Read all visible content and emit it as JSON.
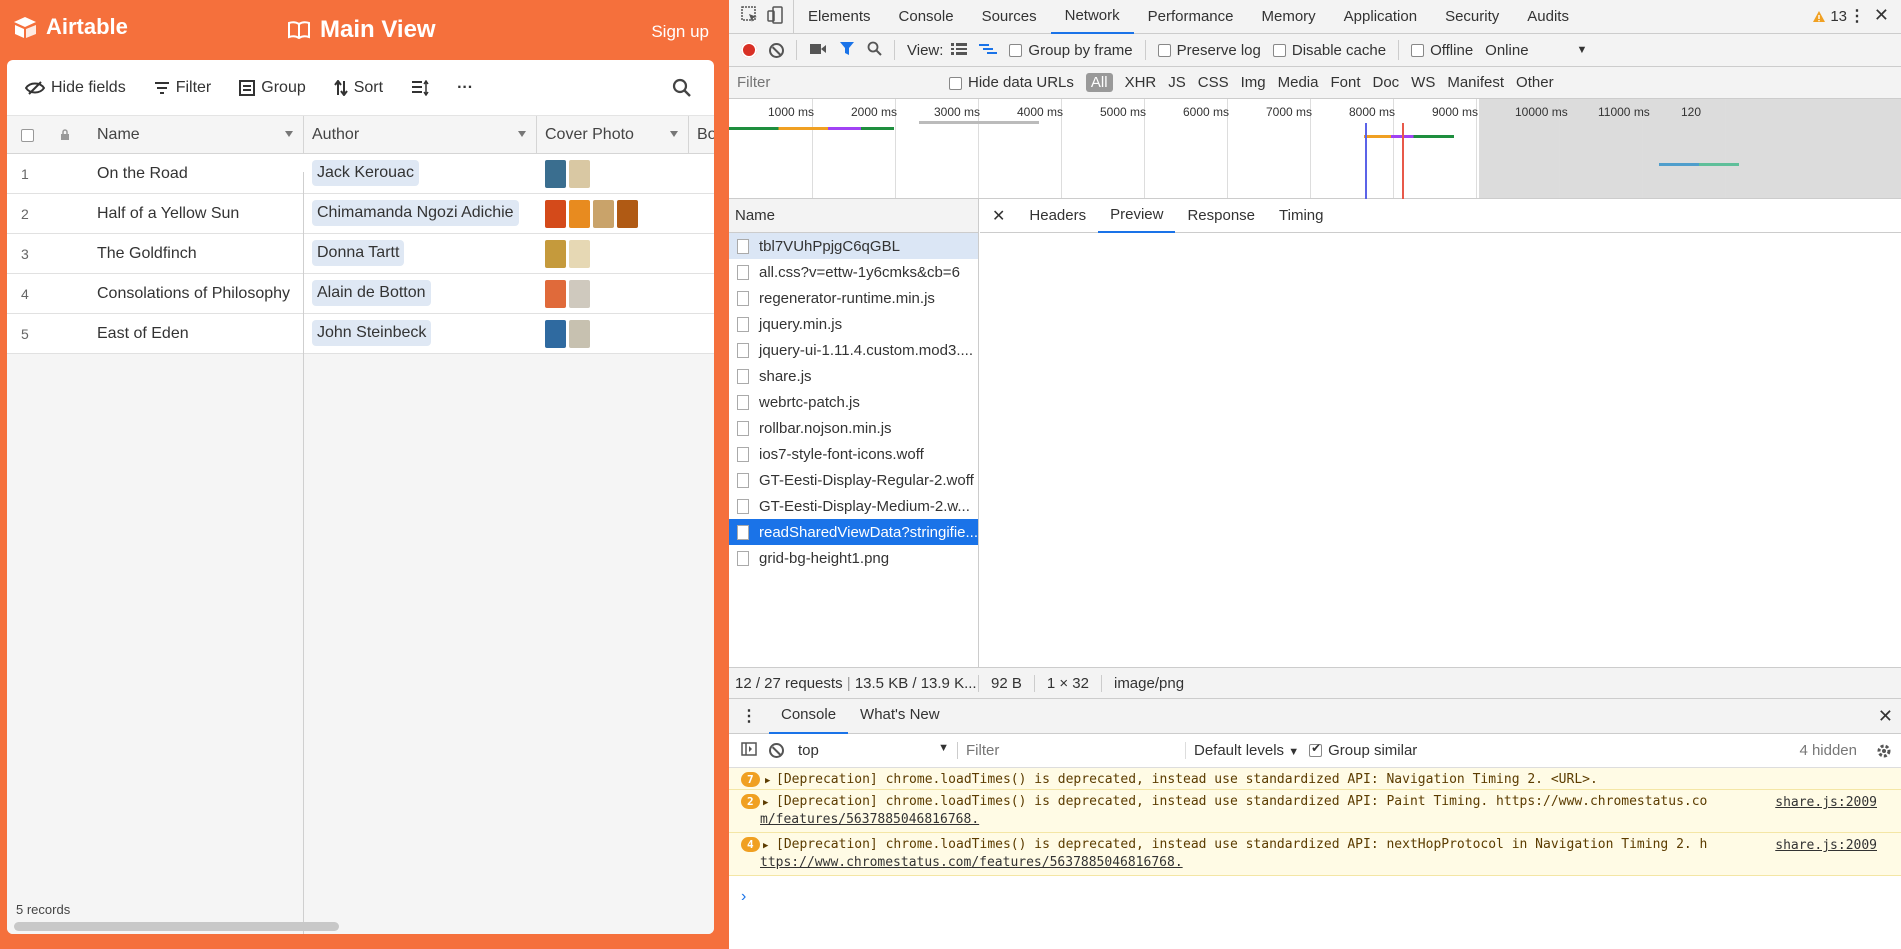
{
  "airtable": {
    "logo_text": "Airtable",
    "view_title": "Main View",
    "signup": "Sign up",
    "toolbar": {
      "hide_fields": "Hide fields",
      "filter": "Filter",
      "group": "Group",
      "sort": "Sort",
      "more": "···"
    },
    "columns": {
      "name": "Name",
      "author": "Author",
      "cover": "Cover Photo",
      "extra": "Bo"
    },
    "rows": [
      {
        "num": "1",
        "name": "On the Road",
        "author": "Jack Kerouac",
        "thumbs": 2
      },
      {
        "num": "2",
        "name": "Half of a Yellow Sun",
        "author": "Chimamanda Ngozi Adichie",
        "thumbs": 4
      },
      {
        "num": "3",
        "name": "The Goldfinch",
        "author": "Donna Tartt",
        "thumbs": 2
      },
      {
        "num": "4",
        "name": "Consolations of Philosophy",
        "author": "Alain de Botton",
        "thumbs": 2
      },
      {
        "num": "5",
        "name": "East of Eden",
        "author": "John Steinbeck",
        "thumbs": 2
      }
    ],
    "records": "5 records",
    "brand_color": "#f5703c"
  },
  "devtools": {
    "tabs": [
      "Elements",
      "Console",
      "Sources",
      "Network",
      "Performance",
      "Memory",
      "Application",
      "Security",
      "Audits"
    ],
    "active_tab": "Network",
    "warning_count": "13",
    "controls": {
      "view": "View:",
      "group_by_frame": "Group by frame",
      "preserve_log": "Preserve log",
      "disable_cache": "Disable cache",
      "offline": "Offline",
      "throttle": "Online"
    },
    "filter": {
      "placeholder": "Filter",
      "hide_data_urls": "Hide data URLs",
      "types": [
        "All",
        "XHR",
        "JS",
        "CSS",
        "Img",
        "Media",
        "Font",
        "Doc",
        "WS",
        "Manifest",
        "Other"
      ]
    },
    "timeline_ticks": [
      "1000 ms",
      "2000 ms",
      "3000 ms",
      "4000 ms",
      "5000 ms",
      "6000 ms",
      "7000 ms",
      "8000 ms",
      "9000 ms",
      "10000 ms",
      "11000 ms",
      "120"
    ],
    "name_header": "Name",
    "requests": [
      "tbl7VUhPpjgC6qGBL",
      "all.css?v=ettw-1y6cmks&cb=6",
      "regenerator-runtime.min.js",
      "jquery.min.js",
      "jquery-ui-1.11.4.custom.mod3....",
      "share.js",
      "webrtc-patch.js",
      "rollbar.nojson.min.js",
      "ios7-style-font-icons.woff",
      "GT-Eesti-Display-Regular-2.woff",
      "GT-Eesti-Display-Medium-2.w...",
      "readSharedViewData?stringifie...",
      "grid-bg-height1.png"
    ],
    "detail_tabs": [
      "Headers",
      "Preview",
      "Response",
      "Timing"
    ],
    "active_detail_tab": "Preview",
    "status": {
      "requests": "12 / 27 requests",
      "transferred": "13.5 KB / 13.9 K...",
      "size": "92 B",
      "dims": "1 × 32",
      "mime": "image/png"
    },
    "drawer_tabs": [
      "Console",
      "What's New"
    ],
    "console": {
      "context": "top",
      "filter_placeholder": "Filter",
      "levels": "Default levels",
      "group_similar": "Group similar",
      "hidden": "4 hidden",
      "messages": [
        {
          "count": "7",
          "line1": "[Deprecation] chrome.loadTimes() is deprecated, instead use standardized API: Navigation Timing 2. <URL>.",
          "line2": "",
          "source": ""
        },
        {
          "count": "2",
          "line1": "[Deprecation] chrome.loadTimes() is deprecated, instead use standardized API: Paint Timing. https://www.chromestatus.co",
          "line2": "m/features/5637885046816768.",
          "source": "share.js:2009"
        },
        {
          "count": "4",
          "line1": "[Deprecation] chrome.loadTimes() is deprecated, instead use standardized API: nextHopProtocol in Navigation Timing 2. h",
          "line2": "ttps://www.chromestatus.com/features/5637885046816768.",
          "source": "share.js:2009"
        }
      ]
    }
  }
}
